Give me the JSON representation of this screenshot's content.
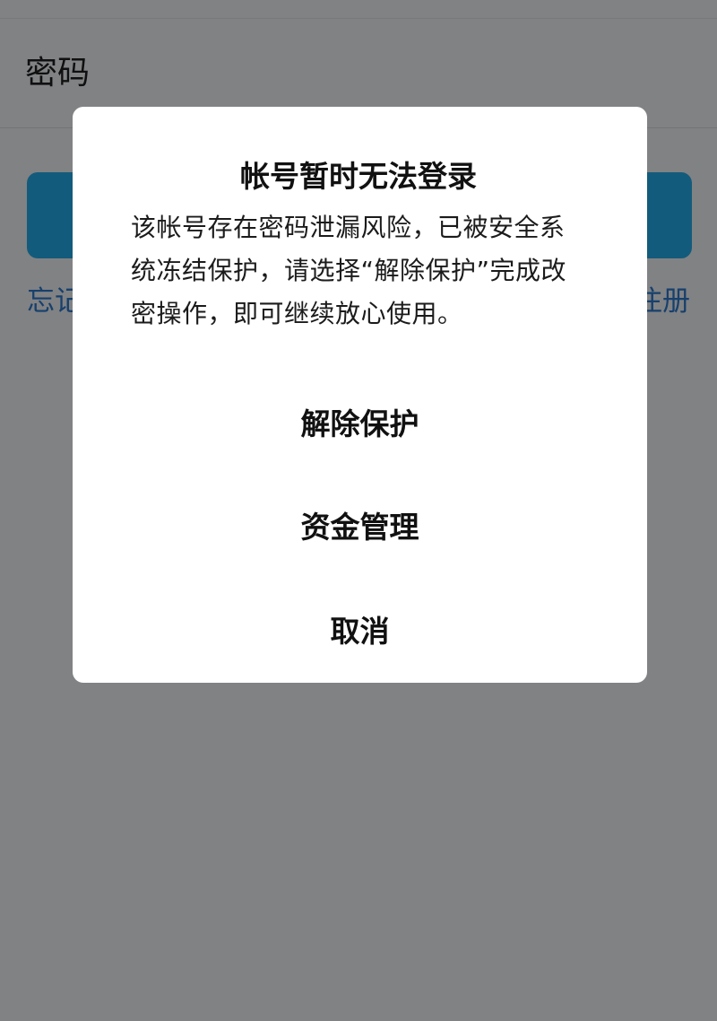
{
  "background": {
    "password_label": "密码",
    "forgot_link": "忘记",
    "register_link": "注册",
    "login_button_color": "#23a9e6",
    "link_color": "#2b77c9"
  },
  "dialog": {
    "title": "帐号暂时无法登录",
    "message": "该帐号存在密码泄漏风险，已被安全系统冻结保护，请选择“解除保护”完成改密操作，即可继续放心使用。",
    "actions": [
      {
        "label": "解除保护"
      },
      {
        "label": "资金管理"
      },
      {
        "label": "取消"
      }
    ]
  }
}
